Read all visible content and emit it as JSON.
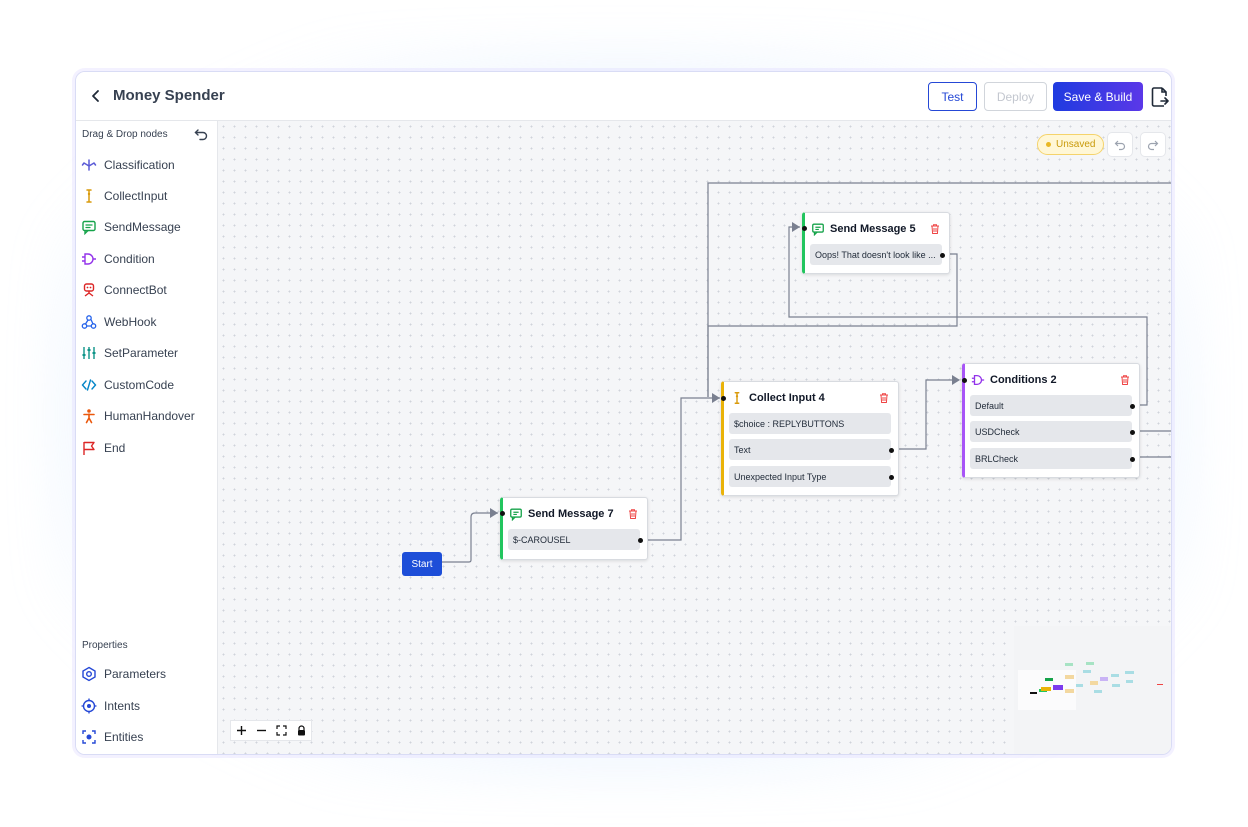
{
  "header": {
    "title": "Money Spender",
    "test_label": "Test",
    "deploy_label": "Deploy",
    "save_build_label": "Save & Build"
  },
  "sidebar": {
    "heading": "Drag & Drop nodes",
    "items": [
      {
        "label": "Classification",
        "icon": "classification-icon",
        "color": "#5b5bd6"
      },
      {
        "label": "CollectInput",
        "icon": "collect-input-icon",
        "color": "#d99a0b"
      },
      {
        "label": "SendMessage",
        "icon": "send-message-icon",
        "color": "#16a34a"
      },
      {
        "label": "Condition",
        "icon": "condition-icon",
        "color": "#9333ea"
      },
      {
        "label": "ConnectBot",
        "icon": "connect-bot-icon",
        "color": "#dc2626"
      },
      {
        "label": "WebHook",
        "icon": "webhook-icon",
        "color": "#2563eb"
      },
      {
        "label": "SetParameter",
        "icon": "set-parameter-icon",
        "color": "#0d9488"
      },
      {
        "label": "CustomCode",
        "icon": "custom-code-icon",
        "color": "#0284c7"
      },
      {
        "label": "HumanHandover",
        "icon": "human-handover-icon",
        "color": "#ea580c"
      },
      {
        "label": "End",
        "icon": "end-flag-icon",
        "color": "#dc2626"
      }
    ],
    "properties_heading": "Properties",
    "properties": [
      {
        "label": "Parameters",
        "icon": "parameters-icon"
      },
      {
        "label": "Intents",
        "icon": "intents-icon"
      },
      {
        "label": "Entities",
        "icon": "entities-icon"
      }
    ]
  },
  "canvas": {
    "status_badge": "Unsaved",
    "start_label": "Start",
    "nodes": {
      "send_message_5": {
        "title": "Send Message 5",
        "rows": [
          "Oops! That doesn't look like ..."
        ]
      },
      "collect_input_4": {
        "title": "Collect Input 4",
        "rows": [
          "$choice : REPLYBUTTONS",
          "Text",
          "Unexpected Input Type"
        ]
      },
      "conditions_2": {
        "title": "Conditions 2",
        "rows": [
          "Default",
          "USDCheck",
          "BRLCheck"
        ]
      },
      "send_message_7": {
        "title": "Send Message 7",
        "rows": [
          "$-CAROUSEL"
        ]
      }
    }
  },
  "colors": {
    "primary": "#2548d6",
    "send_message": "#22c55e",
    "collect_input": "#eab308",
    "condition": "#a855f7"
  }
}
